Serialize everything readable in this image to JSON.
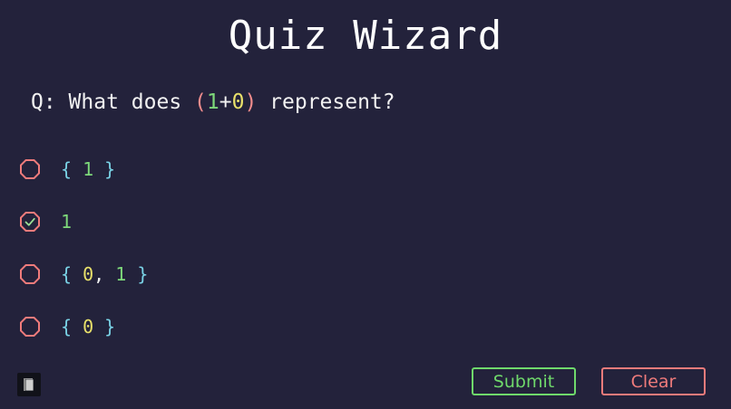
{
  "title": "Quiz Wizard",
  "question": {
    "prefix": "Q: What does ",
    "open_paren": "(",
    "term_a": "1",
    "operator": "+",
    "term_b": "0",
    "close_paren": ")",
    "suffix": " represent?"
  },
  "options": [
    {
      "selected": false,
      "open": "{ ",
      "v1": "1",
      "sep": "",
      "v2": "",
      "close": " }"
    },
    {
      "selected": true,
      "open": "",
      "v1": "1",
      "sep": "",
      "v2": "",
      "close": ""
    },
    {
      "selected": false,
      "open": "{ ",
      "v1": "0",
      "sep": ", ",
      "v2": "1",
      "close": " }"
    },
    {
      "selected": false,
      "open": "{ ",
      "v1": "0",
      "sep": "",
      "v2": "",
      "close": " }"
    }
  ],
  "buttons": {
    "submit": "Submit",
    "clear": "Clear"
  },
  "icons": {
    "radio": "octagon-radio-icon",
    "check": "check-icon",
    "book": "book-icon"
  },
  "colors": {
    "background": "#23223b",
    "green": "#7dd87a",
    "yellow": "#e8e06a",
    "cyan": "#7ad3e6",
    "red": "#ef7b7b"
  }
}
